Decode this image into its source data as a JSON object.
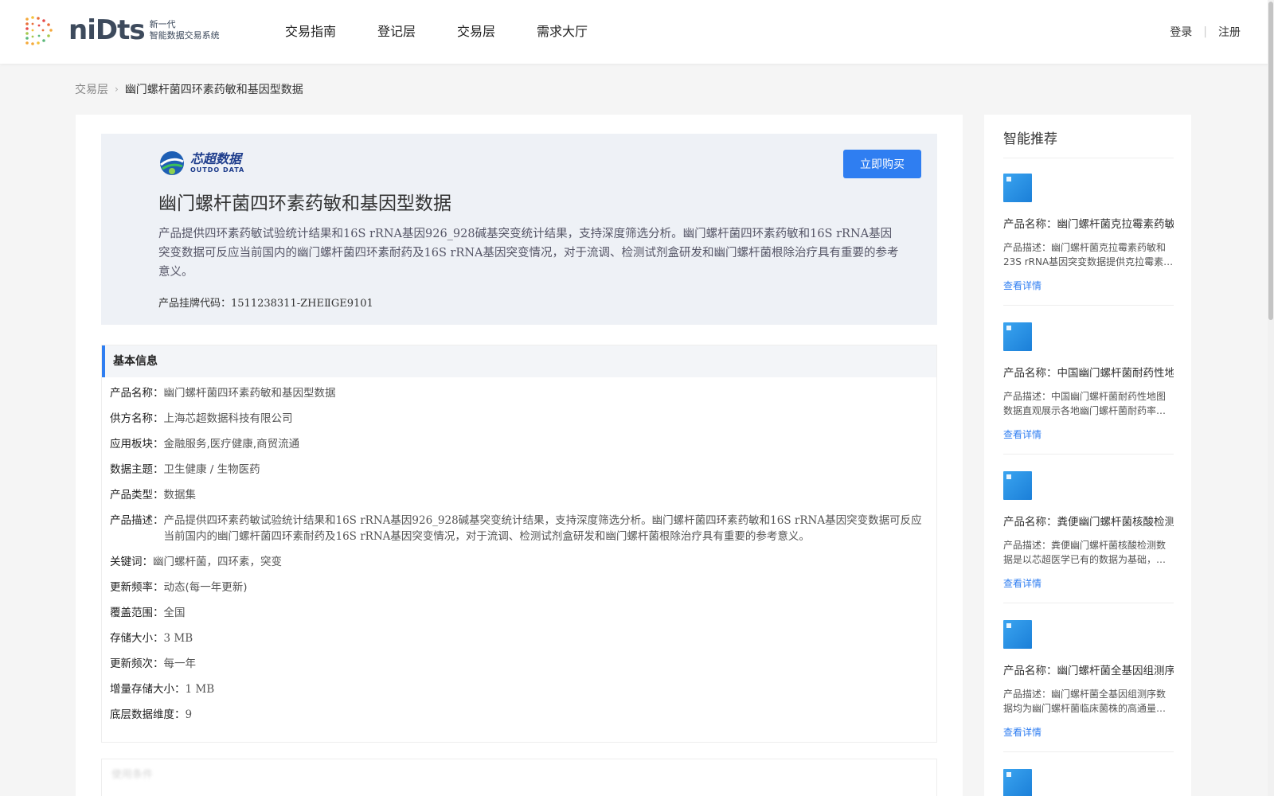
{
  "header": {
    "logo_word": "niDts",
    "logo_sub_line1": "新一代",
    "logo_sub_line2": "智能数据交易系统",
    "nav": [
      "交易指南",
      "登记层",
      "交易层",
      "需求大厅"
    ],
    "login": "登录",
    "register": "注册",
    "auth_separator": "|"
  },
  "breadcrumb": {
    "root": "交易层",
    "current": "幽门螺杆菌四环素药敏和基因型数据"
  },
  "hero": {
    "brand_cn": "芯超数据",
    "brand_en": "OUTDO DATA",
    "buy_label": "立即购买",
    "title": "幽门螺杆菌四环素药敏和基因型数据",
    "description": "产品提供四环素药敏试验统计结果和16S rRNA基因926_928碱基突变统计结果，支持深度筛选分析。幽门螺杆菌四环素药敏和16S rRNA基因突变数据可反应当前国内的幽门螺杆菌四环素耐药及16S rRNA基因突变情况，对于流调、检测试剂盒研发和幽门螺杆菌根除治疗具有重要的参考意义。",
    "code_label": "产品挂牌代码：",
    "code_value": "1511238311-ZHEⅡGE9101"
  },
  "basic_info": {
    "title": "基本信息",
    "rows": [
      {
        "k": "产品名称：",
        "v": "幽门螺杆菌四环素药敏和基因型数据"
      },
      {
        "k": "供方名称：",
        "v": "上海芯超数据科技有限公司"
      },
      {
        "k": "应用板块：",
        "v": "金融服务,医疗健康,商贸流通"
      },
      {
        "k": "数据主题：",
        "v": "卫生健康 / 生物医药"
      },
      {
        "k": "产品类型：",
        "v": "数据集"
      },
      {
        "k": "产品描述：",
        "v": "产品提供四环素药敏试验统计结果和16S rRNA基因926_928碱基突变统计结果，支持深度筛选分析。幽门螺杆菌四环素药敏和16S rRNA基因突变数据可反应当前国内的幽门螺杆菌四环素耐药及16S rRNA基因突变情况，对于流调、检测试剂盒研发和幽门螺杆菌根除治疗具有重要的参考意义。"
      },
      {
        "k": "关键词：",
        "v": "幽门螺杆菌，四环素，突变"
      },
      {
        "k": "更新频率：",
        "v": "动态(每一年更新)"
      },
      {
        "k": "覆盖范围：",
        "v": "全国"
      },
      {
        "k": "存储大小：",
        "v": "3 MB"
      },
      {
        "k": "更新频次：",
        "v": "每一年"
      },
      {
        "k": "增量存储大小：",
        "v": "1 MB"
      },
      {
        "k": "底层数据维度：",
        "v": "9"
      }
    ]
  },
  "next_section_title": "使用条件",
  "sidebar": {
    "title": "智能推荐",
    "items": [
      {
        "name": "产品名称：幽门螺杆菌克拉霉素药敏",
        "desc": "产品描述：幽门螺杆菌克拉霉素药敏和23S rRNA基因突变数据提供克拉霉素…",
        "more": "查看详情"
      },
      {
        "name": "产品名称：中国幽门螺杆菌耐药性地",
        "desc": "产品描述：中国幽门螺杆菌耐药性地图数据直观展示各地幽门螺杆菌耐药率…",
        "more": "查看详情"
      },
      {
        "name": "产品名称：粪便幽门螺杆菌核酸检测",
        "desc": "产品描述：粪便幽门螺杆菌核酸检测数据是以芯超医学已有的数据为基础，…",
        "more": "查看详情"
      },
      {
        "name": "产品名称：幽门螺杆菌全基因组测序",
        "desc": "产品描述：幽门螺杆菌全基因组测序数据均为幽门螺杆菌临床菌株的高通量…",
        "more": "查看详情"
      }
    ]
  },
  "colors": {
    "accent": "#2f7ef1",
    "hero_bg": "#eef1f6",
    "brand_blue": "#1e3d8c"
  }
}
